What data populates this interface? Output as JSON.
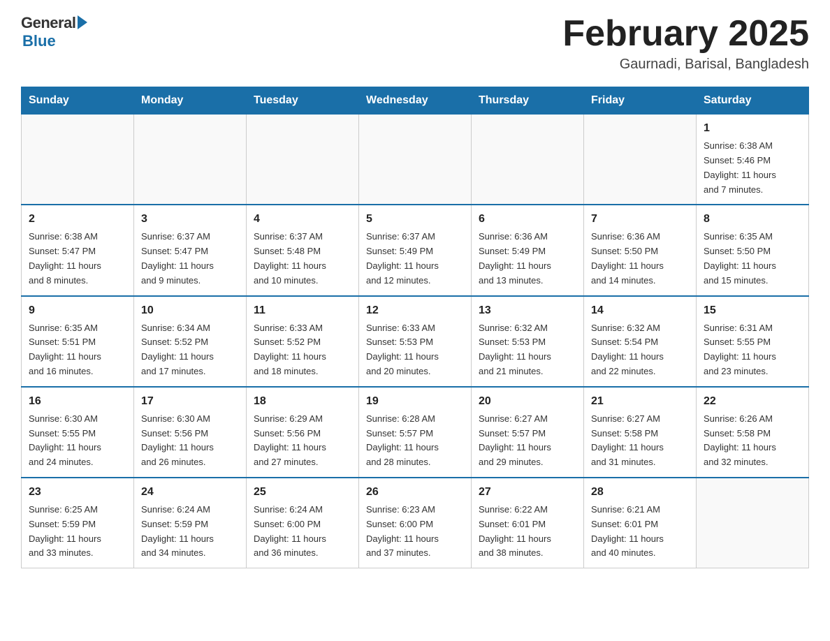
{
  "logo": {
    "general": "General",
    "blue": "Blue"
  },
  "title": "February 2025",
  "location": "Gaurnadi, Barisal, Bangladesh",
  "days_of_week": [
    "Sunday",
    "Monday",
    "Tuesday",
    "Wednesday",
    "Thursday",
    "Friday",
    "Saturday"
  ],
  "weeks": [
    [
      {
        "day": "",
        "info": ""
      },
      {
        "day": "",
        "info": ""
      },
      {
        "day": "",
        "info": ""
      },
      {
        "day": "",
        "info": ""
      },
      {
        "day": "",
        "info": ""
      },
      {
        "day": "",
        "info": ""
      },
      {
        "day": "1",
        "info": "Sunrise: 6:38 AM\nSunset: 5:46 PM\nDaylight: 11 hours\nand 7 minutes."
      }
    ],
    [
      {
        "day": "2",
        "info": "Sunrise: 6:38 AM\nSunset: 5:47 PM\nDaylight: 11 hours\nand 8 minutes."
      },
      {
        "day": "3",
        "info": "Sunrise: 6:37 AM\nSunset: 5:47 PM\nDaylight: 11 hours\nand 9 minutes."
      },
      {
        "day": "4",
        "info": "Sunrise: 6:37 AM\nSunset: 5:48 PM\nDaylight: 11 hours\nand 10 minutes."
      },
      {
        "day": "5",
        "info": "Sunrise: 6:37 AM\nSunset: 5:49 PM\nDaylight: 11 hours\nand 12 minutes."
      },
      {
        "day": "6",
        "info": "Sunrise: 6:36 AM\nSunset: 5:49 PM\nDaylight: 11 hours\nand 13 minutes."
      },
      {
        "day": "7",
        "info": "Sunrise: 6:36 AM\nSunset: 5:50 PM\nDaylight: 11 hours\nand 14 minutes."
      },
      {
        "day": "8",
        "info": "Sunrise: 6:35 AM\nSunset: 5:50 PM\nDaylight: 11 hours\nand 15 minutes."
      }
    ],
    [
      {
        "day": "9",
        "info": "Sunrise: 6:35 AM\nSunset: 5:51 PM\nDaylight: 11 hours\nand 16 minutes."
      },
      {
        "day": "10",
        "info": "Sunrise: 6:34 AM\nSunset: 5:52 PM\nDaylight: 11 hours\nand 17 minutes."
      },
      {
        "day": "11",
        "info": "Sunrise: 6:33 AM\nSunset: 5:52 PM\nDaylight: 11 hours\nand 18 minutes."
      },
      {
        "day": "12",
        "info": "Sunrise: 6:33 AM\nSunset: 5:53 PM\nDaylight: 11 hours\nand 20 minutes."
      },
      {
        "day": "13",
        "info": "Sunrise: 6:32 AM\nSunset: 5:53 PM\nDaylight: 11 hours\nand 21 minutes."
      },
      {
        "day": "14",
        "info": "Sunrise: 6:32 AM\nSunset: 5:54 PM\nDaylight: 11 hours\nand 22 minutes."
      },
      {
        "day": "15",
        "info": "Sunrise: 6:31 AM\nSunset: 5:55 PM\nDaylight: 11 hours\nand 23 minutes."
      }
    ],
    [
      {
        "day": "16",
        "info": "Sunrise: 6:30 AM\nSunset: 5:55 PM\nDaylight: 11 hours\nand 24 minutes."
      },
      {
        "day": "17",
        "info": "Sunrise: 6:30 AM\nSunset: 5:56 PM\nDaylight: 11 hours\nand 26 minutes."
      },
      {
        "day": "18",
        "info": "Sunrise: 6:29 AM\nSunset: 5:56 PM\nDaylight: 11 hours\nand 27 minutes."
      },
      {
        "day": "19",
        "info": "Sunrise: 6:28 AM\nSunset: 5:57 PM\nDaylight: 11 hours\nand 28 minutes."
      },
      {
        "day": "20",
        "info": "Sunrise: 6:27 AM\nSunset: 5:57 PM\nDaylight: 11 hours\nand 29 minutes."
      },
      {
        "day": "21",
        "info": "Sunrise: 6:27 AM\nSunset: 5:58 PM\nDaylight: 11 hours\nand 31 minutes."
      },
      {
        "day": "22",
        "info": "Sunrise: 6:26 AM\nSunset: 5:58 PM\nDaylight: 11 hours\nand 32 minutes."
      }
    ],
    [
      {
        "day": "23",
        "info": "Sunrise: 6:25 AM\nSunset: 5:59 PM\nDaylight: 11 hours\nand 33 minutes."
      },
      {
        "day": "24",
        "info": "Sunrise: 6:24 AM\nSunset: 5:59 PM\nDaylight: 11 hours\nand 34 minutes."
      },
      {
        "day": "25",
        "info": "Sunrise: 6:24 AM\nSunset: 6:00 PM\nDaylight: 11 hours\nand 36 minutes."
      },
      {
        "day": "26",
        "info": "Sunrise: 6:23 AM\nSunset: 6:00 PM\nDaylight: 11 hours\nand 37 minutes."
      },
      {
        "day": "27",
        "info": "Sunrise: 6:22 AM\nSunset: 6:01 PM\nDaylight: 11 hours\nand 38 minutes."
      },
      {
        "day": "28",
        "info": "Sunrise: 6:21 AM\nSunset: 6:01 PM\nDaylight: 11 hours\nand 40 minutes."
      },
      {
        "day": "",
        "info": ""
      }
    ]
  ]
}
